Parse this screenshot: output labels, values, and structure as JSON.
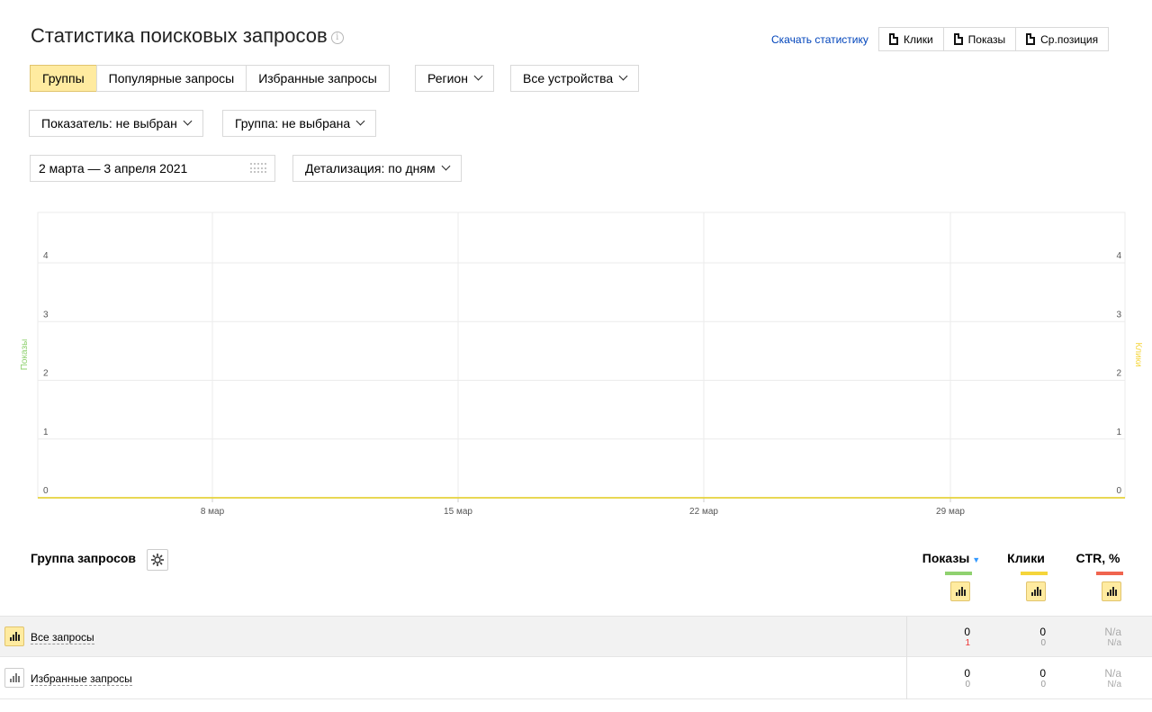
{
  "header": {
    "title": "Статистика поисковых запросов",
    "info_glyph": "i",
    "download_link": "Скачать статистику",
    "export_buttons": [
      "Клики",
      "Показы",
      "Ср.позиция"
    ]
  },
  "filters": {
    "tabs": [
      {
        "label": "Группы",
        "active": true
      },
      {
        "label": "Популярные запросы",
        "active": false
      },
      {
        "label": "Избранные запросы",
        "active": false
      }
    ],
    "region_label": "Регион",
    "devices_label": "Все устройства",
    "metric_label": "Показатель: не выбран",
    "group_label": "Группа: не выбрана",
    "date_range": "2 марта — 3 апреля 2021",
    "detail_label": "Детализация: по дням"
  },
  "chart_data": {
    "type": "line",
    "x_tick_labels": [
      "8 мар",
      "15 мар",
      "22 мар",
      "29 мар"
    ],
    "y_ticks_left": [
      0,
      1,
      2,
      3,
      4
    ],
    "y_ticks_right": [
      0,
      1,
      2,
      3,
      4
    ],
    "ylim": [
      0,
      4
    ],
    "ylabel_left": "Показы",
    "ylabel_right": "Клики",
    "grid": true,
    "series": [
      {
        "name": "Показы",
        "color": "#8bc34a",
        "values": [
          0
        ]
      },
      {
        "name": "Клики",
        "color": "#f5d53a",
        "values": [
          0
        ]
      }
    ]
  },
  "table": {
    "group_header": "Группа запросов",
    "columns": [
      {
        "label": "Показы",
        "sorted": true,
        "color": "#8fd16f"
      },
      {
        "label": "Клики",
        "sorted": false,
        "color": "#f5d53a"
      },
      {
        "label": "CTR, %",
        "sorted": false,
        "color": "#f0644f"
      }
    ],
    "rows": [
      {
        "label": "Все запросы",
        "highlight": true,
        "shows": "0",
        "shows_sub": "1",
        "clicks": "0",
        "clicks_sub": "0",
        "ctr": "N/a",
        "ctr_sub": "N/a"
      },
      {
        "label": "Избранные запросы",
        "highlight": false,
        "shows": "0",
        "shows_sub": "0",
        "clicks": "0",
        "clicks_sub": "0",
        "ctr": "N/a",
        "ctr_sub": "N/a"
      }
    ]
  },
  "colors": {
    "accent_yellow": "#ffeba0",
    "link_blue": "#0044bb",
    "shows_green": "#8fd16f",
    "clicks_yellow": "#f5d53a",
    "ctr_red": "#f0644f"
  }
}
